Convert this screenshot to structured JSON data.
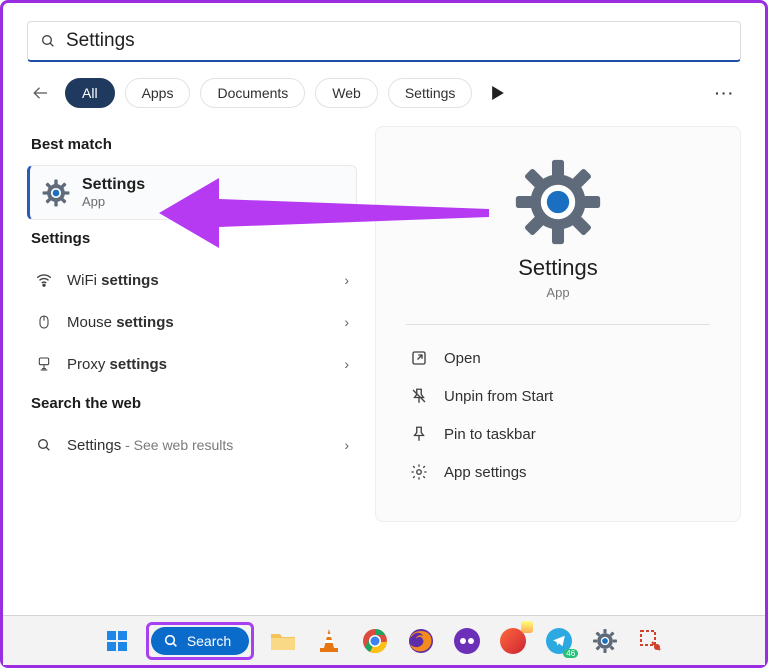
{
  "search": {
    "value": "Settings"
  },
  "filters": {
    "items": [
      {
        "label": "All",
        "active": true
      },
      {
        "label": "Apps",
        "active": false
      },
      {
        "label": "Documents",
        "active": false
      },
      {
        "label": "Web",
        "active": false
      },
      {
        "label": "Settings",
        "active": false
      }
    ]
  },
  "sections": {
    "best_match_title": "Best match",
    "settings_title": "Settings",
    "web_title": "Search the web"
  },
  "best_match": {
    "title": "Settings",
    "subtitle": "App"
  },
  "settings_list": [
    {
      "icon": "wifi",
      "prefix": "WiFi ",
      "bold": "settings"
    },
    {
      "icon": "mouse",
      "prefix": "Mouse ",
      "bold": "settings"
    },
    {
      "icon": "proxy",
      "prefix": "Proxy ",
      "bold": "settings"
    }
  ],
  "web_list": [
    {
      "icon": "search",
      "prefix": "Settings",
      "bold": "",
      "detail": " - See web results"
    }
  ],
  "preview": {
    "title": "Settings",
    "subtitle": "App",
    "actions": [
      {
        "icon": "open",
        "label": "Open"
      },
      {
        "icon": "unpin",
        "label": "Unpin from Start"
      },
      {
        "icon": "pin",
        "label": "Pin to taskbar"
      },
      {
        "icon": "gear",
        "label": "App settings"
      }
    ]
  },
  "taskbar": {
    "search_label": "Search",
    "telegram_badge": "46"
  }
}
